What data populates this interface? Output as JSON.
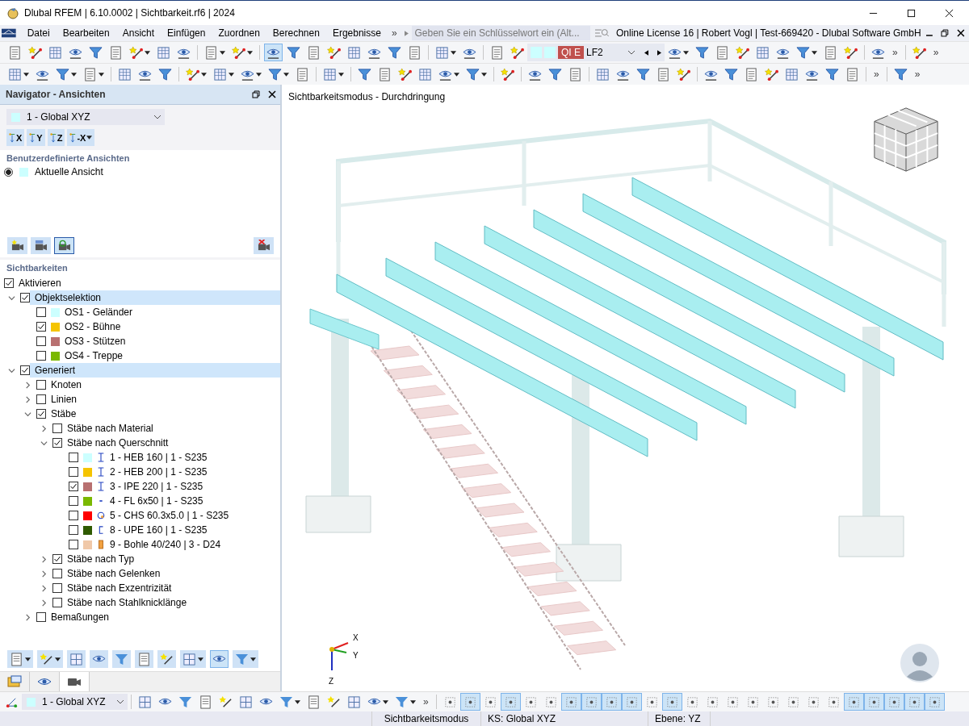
{
  "window": {
    "title": "Dlubal RFEM | 6.10.0002 | Sichtbarkeit.rf6 | 2024"
  },
  "menu": {
    "items": [
      "Datei",
      "Bearbeiten",
      "Ansicht",
      "Einfügen",
      "Zuordnen",
      "Berechnen",
      "Ergebnisse"
    ],
    "more": "»",
    "search": {
      "placeholder": "Geben Sie ein Schlüsselwort ein (Alt..."
    },
    "license": "Online License 16 | Robert Vogl | Test-669420 - Dlubal Software GmbH"
  },
  "toolbars": [
    {
      "items": [
        {
          "kind": "button",
          "pressed": false,
          "dropdown": false
        },
        {
          "kind": "button",
          "pressed": false,
          "dropdown": false
        },
        {
          "kind": "button",
          "pressed": false,
          "dropdown": false
        },
        {
          "kind": "button",
          "pressed": false,
          "dropdown": false
        },
        {
          "kind": "button",
          "pressed": false,
          "dropdown": false
        },
        {
          "kind": "button",
          "pressed": false,
          "dropdown": false
        },
        {
          "kind": "button",
          "pressed": false,
          "dropdown": true
        },
        {
          "kind": "button",
          "pressed": false,
          "dropdown": false
        },
        {
          "kind": "button",
          "pressed": false,
          "dropdown": false
        },
        {
          "kind": "separator"
        },
        {
          "kind": "button",
          "pressed": false,
          "dropdown": true
        },
        {
          "kind": "button",
          "pressed": false,
          "dropdown": true
        },
        {
          "kind": "separator"
        },
        {
          "kind": "button",
          "pressed": true,
          "dropdown": false
        },
        {
          "kind": "button",
          "pressed": false,
          "dropdown": false
        },
        {
          "kind": "button",
          "pressed": false,
          "dropdown": false
        },
        {
          "kind": "button",
          "pressed": false,
          "dropdown": false
        },
        {
          "kind": "button",
          "pressed": false,
          "dropdown": false
        },
        {
          "kind": "button",
          "pressed": false,
          "dropdown": false
        },
        {
          "kind": "button",
          "pressed": false,
          "dropdown": false
        },
        {
          "kind": "button",
          "pressed": false,
          "dropdown": false
        },
        {
          "kind": "separator"
        },
        {
          "kind": "button",
          "pressed": false,
          "dropdown": true
        },
        {
          "kind": "button",
          "pressed": false,
          "dropdown": false
        },
        {
          "kind": "separator"
        },
        {
          "kind": "button",
          "pressed": false,
          "dropdown": false
        },
        {
          "kind": "button",
          "pressed": false,
          "dropdown": false
        },
        {
          "kind": "loadcase",
          "badge": "QI E",
          "value": "LF2"
        },
        {
          "kind": "button",
          "pressed": false,
          "dropdown": true
        },
        {
          "kind": "button",
          "pressed": false,
          "dropdown": false
        },
        {
          "kind": "button",
          "pressed": false,
          "dropdown": false
        },
        {
          "kind": "button",
          "pressed": false,
          "dropdown": false
        },
        {
          "kind": "button",
          "pressed": false,
          "dropdown": false
        },
        {
          "kind": "button",
          "pressed": false,
          "dropdown": false
        },
        {
          "kind": "button",
          "pressed": false,
          "dropdown": true
        },
        {
          "kind": "button",
          "pressed": false,
          "dropdown": false
        },
        {
          "kind": "button",
          "pressed": false,
          "dropdown": false
        },
        {
          "kind": "separator"
        },
        {
          "kind": "button",
          "pressed": false,
          "dropdown": false
        },
        {
          "kind": "more",
          "label": "»"
        },
        {
          "kind": "separator"
        },
        {
          "kind": "button",
          "pressed": false,
          "dropdown": false
        },
        {
          "kind": "more",
          "label": "»"
        }
      ]
    },
    {
      "items": [
        {
          "kind": "button",
          "pressed": false,
          "dropdown": true
        },
        {
          "kind": "button",
          "pressed": false,
          "dropdown": false
        },
        {
          "kind": "button",
          "pressed": false,
          "dropdown": true
        },
        {
          "kind": "button",
          "pressed": false,
          "dropdown": true
        },
        {
          "kind": "separator"
        },
        {
          "kind": "button",
          "pressed": false,
          "dropdown": false
        },
        {
          "kind": "button",
          "pressed": false,
          "dropdown": false
        },
        {
          "kind": "button",
          "pressed": false,
          "dropdown": false
        },
        {
          "kind": "separator"
        },
        {
          "kind": "button",
          "pressed": false,
          "dropdown": true
        },
        {
          "kind": "button",
          "pressed": false,
          "dropdown": true
        },
        {
          "kind": "button",
          "pressed": false,
          "dropdown": true
        },
        {
          "kind": "button",
          "pressed": false,
          "dropdown": true
        },
        {
          "kind": "button",
          "pressed": false,
          "dropdown": false
        },
        {
          "kind": "separator"
        },
        {
          "kind": "button",
          "pressed": false,
          "dropdown": true
        },
        {
          "kind": "separator"
        },
        {
          "kind": "button",
          "pressed": false,
          "dropdown": false
        },
        {
          "kind": "button",
          "pressed": false,
          "dropdown": false
        },
        {
          "kind": "button",
          "pressed": false,
          "dropdown": false
        },
        {
          "kind": "button",
          "pressed": false,
          "dropdown": false
        },
        {
          "kind": "button",
          "pressed": false,
          "dropdown": true
        },
        {
          "kind": "button",
          "pressed": false,
          "dropdown": true
        },
        {
          "kind": "separator"
        },
        {
          "kind": "button",
          "pressed": false,
          "dropdown": false
        },
        {
          "kind": "separator"
        },
        {
          "kind": "button",
          "pressed": false,
          "dropdown": false
        },
        {
          "kind": "button",
          "pressed": false,
          "dropdown": false
        },
        {
          "kind": "button",
          "pressed": false,
          "dropdown": false
        },
        {
          "kind": "separator"
        },
        {
          "kind": "button",
          "pressed": false,
          "dropdown": false
        },
        {
          "kind": "button",
          "pressed": false,
          "dropdown": false
        },
        {
          "kind": "button",
          "pressed": false,
          "dropdown": false
        },
        {
          "kind": "button",
          "pressed": false,
          "dropdown": false
        },
        {
          "kind": "button",
          "pressed": false,
          "dropdown": false
        },
        {
          "kind": "separator"
        },
        {
          "kind": "button",
          "pressed": false,
          "dropdown": false
        },
        {
          "kind": "button",
          "pressed": false,
          "dropdown": false
        },
        {
          "kind": "button",
          "pressed": false,
          "dropdown": false
        },
        {
          "kind": "button",
          "pressed": false,
          "dropdown": false
        },
        {
          "kind": "button",
          "pressed": false,
          "dropdown": false
        },
        {
          "kind": "button",
          "pressed": false,
          "dropdown": false
        },
        {
          "kind": "button",
          "pressed": false,
          "dropdown": false
        },
        {
          "kind": "button",
          "pressed": false,
          "dropdown": false
        },
        {
          "kind": "separator"
        },
        {
          "kind": "more",
          "label": "»"
        },
        {
          "kind": "separator"
        },
        {
          "kind": "button",
          "pressed": false,
          "dropdown": false
        },
        {
          "kind": "more",
          "label": "»"
        }
      ]
    }
  ],
  "navigator": {
    "title": "Navigator - Ansichten",
    "view_select": {
      "value": "1 - Global XYZ",
      "color": "#ccffff"
    },
    "axis_buttons": [
      {
        "label": "X",
        "dropdown": false
      },
      {
        "label": "Y",
        "dropdown": false
      },
      {
        "label": "Z",
        "dropdown": false
      },
      {
        "label": "-X",
        "dropdown": true
      }
    ],
    "custom_views": {
      "heading": "Benutzerdefinierte Ansichten",
      "items": [
        {
          "label": "Aktuelle Ansicht",
          "selected": true,
          "color": "#ccffff"
        }
      ]
    },
    "camera_buttons": [
      {
        "kind": "new",
        "pressed": false
      },
      {
        "kind": "save",
        "pressed": false
      },
      {
        "kind": "refresh",
        "pressed": true
      },
      {
        "kind": "delete",
        "pressed": false
      }
    ],
    "visibility": {
      "heading": "Sichtbarkeiten",
      "activate": {
        "label": "Aktivieren",
        "checked": true
      },
      "tree": [
        {
          "label": "Objektselektion",
          "checked": true,
          "expanded": true,
          "selected": true,
          "children": [
            {
              "label": "OS1 - Geländer",
              "checked": false,
              "selected": false,
              "color": "#ccffff"
            },
            {
              "label": "OS2 - Bühne",
              "checked": true,
              "selected": false,
              "color": "#f5c400"
            },
            {
              "label": "OS3 - Stützen",
              "checked": false,
              "selected": false,
              "color": "#b87070"
            },
            {
              "label": "OS4 - Treppe",
              "checked": false,
              "selected": false,
              "color": "#7ab800"
            }
          ]
        },
        {
          "label": "Generiert",
          "checked": true,
          "expanded": true,
          "selected": true,
          "children": [
            {
              "label": "Knoten",
              "checked": false,
              "expanded": false,
              "selected": false
            },
            {
              "label": "Linien",
              "checked": false,
              "expanded": false,
              "selected": false
            },
            {
              "label": "Stäbe",
              "checked": true,
              "expanded": true,
              "selected": false,
              "children": [
                {
                  "label": "Stäbe nach Material",
                  "checked": false,
                  "expanded": false,
                  "selected": false
                },
                {
                  "label": "Stäbe nach Querschnitt",
                  "checked": true,
                  "expanded": true,
                  "selected": false,
                  "children": [
                    {
                      "label": "1 - HEB 160 | 1 - S235",
                      "checked": false,
                      "selected": false,
                      "color": "#ccffff",
                      "kind": "i_beam"
                    },
                    {
                      "label": "2 - HEB 200 | 1 - S235",
                      "checked": false,
                      "selected": false,
                      "color": "#f5c400",
                      "kind": "i_beam"
                    },
                    {
                      "label": "3 - IPE 220 | 1 - S235",
                      "checked": true,
                      "selected": false,
                      "color": "#b87070",
                      "kind": "i_beam"
                    },
                    {
                      "label": "4 - FL 6x50 | 1 - S235",
                      "checked": false,
                      "selected": false,
                      "color": "#7ab800",
                      "kind": "flat"
                    },
                    {
                      "label": "5 - CHS 60.3x5.0 | 1 - S235",
                      "checked": false,
                      "selected": false,
                      "color": "#ff0000",
                      "kind": "pipe"
                    },
                    {
                      "label": "8 - UPE 160 | 1 - S235",
                      "checked": false,
                      "selected": false,
                      "color": "#2f5a00",
                      "kind": "channel"
                    },
                    {
                      "label": "9 - Bohle 40/240 | 3 - D24",
                      "checked": false,
                      "selected": false,
                      "color": "#f0c8a8",
                      "kind": "plank"
                    }
                  ]
                },
                {
                  "label": "Stäbe nach Typ",
                  "checked": true,
                  "expanded": false,
                  "selected": false
                },
                {
                  "label": "Stäbe nach Gelenken",
                  "checked": false,
                  "expanded": false,
                  "selected": false
                },
                {
                  "label": "Stäbe nach Exzentrizität",
                  "checked": false,
                  "expanded": false,
                  "selected": false
                },
                {
                  "label": "Stäbe nach Stahlknicklänge",
                  "checked": false,
                  "expanded": false,
                  "selected": false
                }
              ]
            },
            {
              "label": "Bemaßungen",
              "checked": false,
              "expanded": false,
              "selected": false
            }
          ]
        }
      ]
    },
    "bottom_buttons": [
      {
        "pressed": false,
        "dropdown": true
      },
      {
        "pressed": false,
        "dropdown": true
      },
      {
        "pressed": false,
        "dropdown": false
      },
      {
        "pressed": false,
        "dropdown": false
      },
      {
        "pressed": false,
        "dropdown": false
      },
      {
        "pressed": false,
        "dropdown": false
      },
      {
        "pressed": false,
        "dropdown": false
      },
      {
        "pressed": false,
        "dropdown": true
      },
      {
        "pressed": true,
        "dropdown": false
      },
      {
        "pressed": false,
        "dropdown": true
      }
    ],
    "tabs": [
      {
        "kind": "navigator",
        "selected": false
      },
      {
        "kind": "eye",
        "selected": false
      },
      {
        "kind": "camera",
        "selected": true
      }
    ]
  },
  "view": {
    "title": "Sichtbarkeitsmodus - Durchdringung",
    "axes": [
      "X",
      "Y",
      "Z"
    ]
  },
  "bottom_toolbar": {
    "view_select": {
      "value": "1 - Global XYZ",
      "color": "#ccffff"
    },
    "more": "»",
    "left_buttons": [
      {
        "pressed": false,
        "dropdown": false
      },
      {
        "pressed": false,
        "dropdown": false
      },
      {
        "pressed": false,
        "dropdown": false
      },
      {
        "pressed": false,
        "dropdown": false
      },
      {
        "pressed": false,
        "dropdown": false
      },
      {
        "pressed": false,
        "dropdown": false
      },
      {
        "pressed": false,
        "dropdown": false
      },
      {
        "pressed": false,
        "dropdown": true
      },
      {
        "pressed": false,
        "dropdown": false
      },
      {
        "pressed": false,
        "dropdown": false
      },
      {
        "pressed": false,
        "dropdown": false
      },
      {
        "pressed": false,
        "dropdown": true
      },
      {
        "pressed": false,
        "dropdown": true
      }
    ],
    "right_buttons": [
      {
        "pressed": false
      },
      {
        "pressed": true
      },
      {
        "pressed": false
      },
      {
        "pressed": true
      },
      {
        "pressed": false
      },
      {
        "pressed": false
      },
      {
        "pressed": true
      },
      {
        "pressed": true
      },
      {
        "pressed": true
      },
      {
        "pressed": true
      },
      {
        "pressed": false
      },
      {
        "pressed": true
      },
      {
        "pressed": false
      },
      {
        "pressed": false
      },
      {
        "pressed": false
      },
      {
        "pressed": false
      },
      {
        "pressed": false
      },
      {
        "pressed": false
      },
      {
        "pressed": false
      },
      {
        "pressed": false
      },
      {
        "pressed": true
      },
      {
        "pressed": true
      },
      {
        "pressed": true
      },
      {
        "pressed": true
      },
      {
        "pressed": true
      }
    ]
  },
  "status_bar": [
    "Sichtbarkeitsmodus",
    "KS: Global XYZ",
    "Ebene: YZ"
  ]
}
